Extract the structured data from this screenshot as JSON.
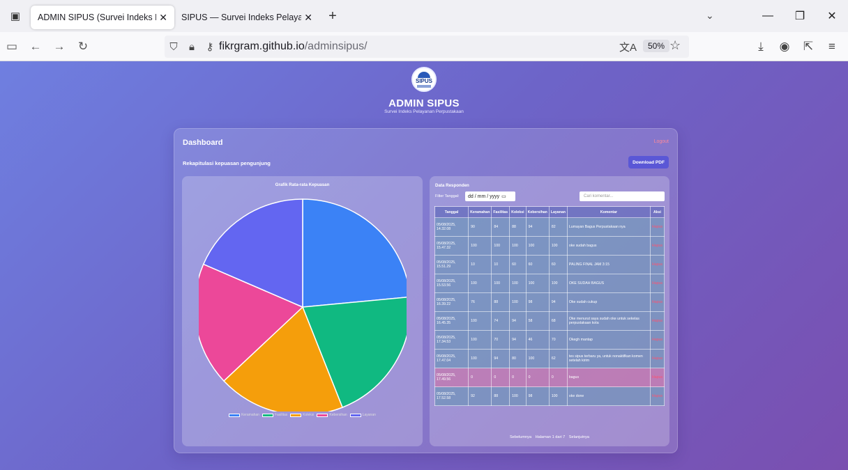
{
  "browser": {
    "tabs": [
      {
        "title": "ADMIN SIPUS (Survei Indeks Pelayanan Pe",
        "active": true
      },
      {
        "title": "SIPUS — Survei Indeks Pelayanan Pe",
        "active": false
      }
    ],
    "url_host": "fikrgram.github.io",
    "url_path": "/adminsipus/",
    "zoom": "50%"
  },
  "header": {
    "logo_text": "SIPUS",
    "title": "ADMIN SIPUS",
    "subtitle": "Survei Indeks Pelayanan Perpustakaan"
  },
  "dashboard": {
    "title": "Dashboard",
    "logout": "Logout",
    "section_title": "Rekapitulasi kepuasan pengunjung",
    "download_label": "Download PDF"
  },
  "chart": {
    "title": "Grafik Rata-rata Kepuasan"
  },
  "chart_data": {
    "type": "pie",
    "title": "Grafik Rata-rata Kepuasan",
    "categories": [
      "Keramahan",
      "Fasilitas",
      "Koleksi",
      "Kebersihan",
      "Layanan"
    ],
    "values": [
      23.5,
      20.5,
      19.0,
      18.5,
      18.5
    ],
    "colors": [
      "#3b82f6",
      "#10b981",
      "#f59e0b",
      "#ec4899",
      "#6366f1"
    ],
    "legend_position": "bottom"
  },
  "responden": {
    "title": "Data Responden",
    "filter_label": "Filter Tanggal:",
    "date_placeholder": "dd / mm / yyyy",
    "search_placeholder": "Cari komentar...",
    "columns": [
      "Tanggal",
      "Keramahan",
      "Fasilitas",
      "Koleksi",
      "Kebersihan",
      "Layanan",
      "Komentar",
      "Aksi"
    ],
    "rows": [
      {
        "tanggal": "05/08/2025, 14.32.08",
        "vals": [
          "90",
          "84",
          "88",
          "94",
          "82"
        ],
        "komentar": "Lumayan Bagus Perpustakaan nya",
        "aksi": "Hapus"
      },
      {
        "tanggal": "05/08/2025, 15.47.32",
        "vals": [
          "100",
          "100",
          "100",
          "100",
          "100"
        ],
        "komentar": "oke sudah bagus",
        "aksi": "Hapus"
      },
      {
        "tanggal": "05/08/2025, 15.51.29",
        "vals": [
          "10",
          "10",
          "60",
          "60",
          "60"
        ],
        "komentar": "PALING FINAL JAM 3:15",
        "aksi": "Hapus"
      },
      {
        "tanggal": "05/08/2025, 15.53.56",
        "vals": [
          "100",
          "100",
          "100",
          "100",
          "100"
        ],
        "komentar": "OKE SUDAH BAGUS",
        "aksi": "Hapus"
      },
      {
        "tanggal": "05/08/2025, 16.39.22",
        "vals": [
          "76",
          "88",
          "100",
          "98",
          "94"
        ],
        "komentar": "Oke sudah cukup",
        "aksi": "Hapus"
      },
      {
        "tanggal": "05/08/2025, 16.45.35",
        "vals": [
          "100",
          "74",
          "94",
          "58",
          "68"
        ],
        "komentar": "Oke menurut saya sudah oke untuk sekelas perpustakaan kota",
        "aksi": "Hapus"
      },
      {
        "tanggal": "05/08/2025, 17.34.53",
        "vals": [
          "100",
          "70",
          "94",
          "46",
          "70"
        ],
        "komentar": "Okegh mantap",
        "aksi": "Hapus"
      },
      {
        "tanggal": "05/08/2025, 17.47.04",
        "vals": [
          "100",
          "94",
          "80",
          "100",
          "62"
        ],
        "komentar": "tes sipus terbaru ya, untuk nonaktifkan komen setelah kirim",
        "aksi": "Hapus"
      },
      {
        "tanggal": "05/08/2025, 17.49.56",
        "vals": [
          "0",
          "0",
          "0",
          "0",
          "0"
        ],
        "komentar": "bagus",
        "aksi": "Hapus",
        "highlight": true
      },
      {
        "tanggal": "05/08/2025, 17.52.58",
        "vals": [
          "92",
          "88",
          "100",
          "98",
          "100"
        ],
        "komentar": "oke done",
        "aksi": "Hapus"
      }
    ],
    "pager": {
      "prev": "Sebelumnya",
      "info": "Halaman 1 dari 7",
      "next": "Selanjutnya"
    }
  }
}
